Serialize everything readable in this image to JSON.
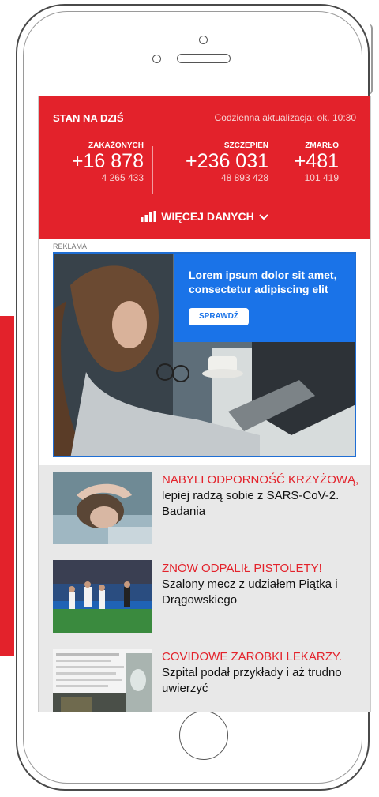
{
  "stats": {
    "title": "STAN NA DZIŚ",
    "update": "Codzienna aktualizacja: ok. 10:30",
    "items": [
      {
        "label": "ZAKAŻONYCH",
        "value": "+16 878",
        "total": "4 265 433"
      },
      {
        "label": "SZCZEPIEŃ",
        "value": "+236 031",
        "total": "48 893 428"
      },
      {
        "label": "ZMARŁO",
        "value": "+481",
        "total": "101 419"
      }
    ],
    "more_label": "WIĘCEJ DANYCH"
  },
  "ad": {
    "label": "REKLAMA",
    "text": "Lorem ipsum dolor sit amet, consectetur adipiscing elit",
    "button_label": "SPRAWDŹ"
  },
  "news": [
    {
      "highlight": "NABYLI ODPORNOŚĆ KRZYŻOWĄ,",
      "rest": " lepiej radzą sobie z SARS-CoV-2. Badania"
    },
    {
      "highlight": "ZNÓW ODPALIŁ PISTOLETY!",
      "rest": " Szalony mecz z udziałem Piątka i Drągowskiego"
    },
    {
      "highlight": "COVIDOWE ZAROBKI LEKARZY.",
      "rest": " Szpital podał przykłady i aż trudno uwierzyć"
    }
  ],
  "colors": {
    "brand_red": "#e3222b",
    "ad_blue": "#1a73e8"
  }
}
